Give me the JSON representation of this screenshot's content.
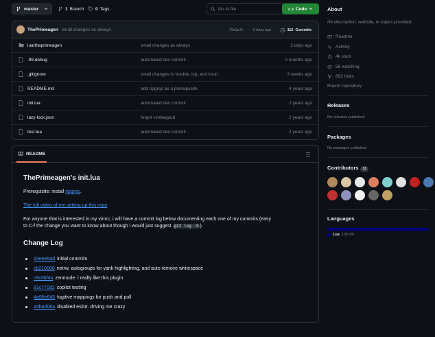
{
  "topbar": {
    "branch": "master",
    "branches_count": "1",
    "branches_label": "Branch",
    "tags_count": "0",
    "tags_label": "Tags",
    "goto_placeholder": "Go to file",
    "code_label": "Code"
  },
  "latest_commit": {
    "author": "ThePrimeagen",
    "message": "small changes as always",
    "hash": "72a1a7e",
    "age": "3 days ago",
    "commits_count": "112",
    "commits_label": "Commits"
  },
  "files": [
    {
      "type": "folder",
      "name": "lua/theprimeagen",
      "message": "small changes as always",
      "date": "3 days ago"
    },
    {
      "type": "file",
      "name": ".99.debug",
      "message": "automated dev commit",
      "date": "2 months ago"
    },
    {
      "type": "file",
      "name": ".gitignore",
      "message": "small changes to trouble, lsp, and local",
      "date": "3 weeks ago"
    },
    {
      "type": "file",
      "name": "README.md",
      "message": "add ripgrep as a prerequisite",
      "date": "4 years ago"
    },
    {
      "type": "file",
      "name": "init.lua",
      "message": "automated dev commit",
      "date": "2 years ago"
    },
    {
      "type": "file",
      "name": "lazy-lock.json",
      "message": "forgot vimbegood",
      "date": "2 years ago"
    },
    {
      "type": "file",
      "name": "test.lua",
      "message": "automated dev commit",
      "date": "2 years ago"
    }
  ],
  "readme": {
    "tab_label": "README",
    "title": "ThePrimeagen's init.lua",
    "prereq_text": "Prerequisite: install ",
    "prereq_link": "ripgrep",
    "prereq_end": ".",
    "video_link": "The full video of me setting up this repo",
    "para_line1": "For anyone that is interested in my vimrc, i will have a commit log below documenting each one of my commits (easy",
    "para_line2_pre": "to C-f the change you want to know about though i would just suggest ",
    "para_code": "git log -S",
    "para_line2_post": ").",
    "changelog_title": "Change Log",
    "changelog": [
      {
        "hash": "33eee9ad",
        "text": "initial commits"
      },
      {
        "hash": "cb210006",
        "text": "netrw, autogroups for yank highlighting, and auto remove whitespace"
      },
      {
        "hash": "c8c0bf4a",
        "text": "zenmode. i really like this plugin"
      },
      {
        "hash": "81c770d2",
        "text": "copilot testing"
      },
      {
        "hash": "4a96e645",
        "text": "fugitive mappings for push and pull"
      },
      {
        "hash": "a3bad06a",
        "text": "disabled eslint. driving me crazy"
      }
    ]
  },
  "sidebar": {
    "about_title": "About",
    "about_desc": "No description, website, or topics provided.",
    "items": [
      {
        "icon": "book-icon",
        "label": "Readme"
      },
      {
        "icon": "pulse-icon",
        "label": "Activity"
      },
      {
        "icon": "star-icon",
        "label": "4k stars"
      },
      {
        "icon": "eye-icon",
        "label": "56 watching"
      },
      {
        "icon": "fork-icon",
        "label": "692 forks"
      }
    ],
    "report": "Report repository",
    "releases_title": "Releases",
    "releases_empty": "No releases published",
    "packages_title": "Packages",
    "packages_empty": "No packages published",
    "contributors_title": "Contributors",
    "contributors_count": "13",
    "languages_title": "Languages",
    "language_name": "Lua",
    "language_pct": "100.0%",
    "language_color": "#000080",
    "avatar_colors": [
      "#b08a5a",
      "#d9c7a7",
      "#e8e8e8",
      "#d98060",
      "#7fd1d1",
      "#e0e0e0",
      "#c02020",
      "#4a7ab0",
      "#c03030",
      "#9090c0",
      "#f0f0f0",
      "#666666",
      "#c0a060"
    ]
  }
}
